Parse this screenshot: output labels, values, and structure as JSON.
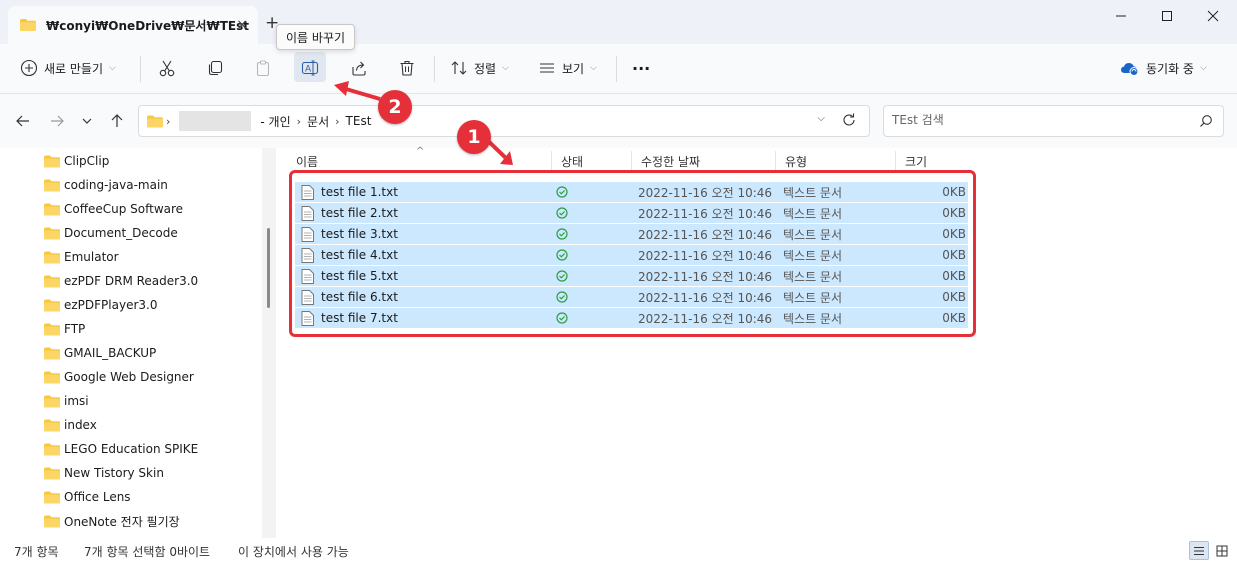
{
  "window": {
    "tab_title": "₩conyi₩OneDrive₩문서₩TEst",
    "tab_close": "×",
    "tab_add": "+"
  },
  "tooltip": {
    "text": "이름 바꾸기"
  },
  "toolbar": {
    "new_label": "새로 만들기",
    "sort_label": "정렬",
    "view_label": "보기",
    "more_label": "···",
    "sync_label": "동기화 중"
  },
  "address": {
    "crumbs": [
      "- 개인",
      "문서",
      "TEst"
    ],
    "search_placeholder": "TEst 검색"
  },
  "sidebar": {
    "items": [
      "ClipClip",
      "coding-java-main",
      "CoffeeCup Software",
      "Document_Decode",
      "Emulator",
      "ezPDF DRM Reader3.0",
      "ezPDFPlayer3.0",
      "FTP",
      "GMAIL_BACKUP",
      "Google Web Designer",
      "imsi",
      "index",
      "LEGO Education SPIKE",
      "New Tistory Skin",
      "Office Lens",
      "OneNote 전자 필기장"
    ]
  },
  "columns": {
    "name": "이름",
    "status": "상태",
    "modified": "수정한 날짜",
    "type": "유형",
    "size": "크기"
  },
  "files": [
    {
      "name": "test file 1.txt",
      "modified": "2022-11-16 오전 10:46",
      "type": "텍스트 문서",
      "size": "0KB"
    },
    {
      "name": "test file 2.txt",
      "modified": "2022-11-16 오전 10:46",
      "type": "텍스트 문서",
      "size": "0KB"
    },
    {
      "name": "test file 3.txt",
      "modified": "2022-11-16 오전 10:46",
      "type": "텍스트 문서",
      "size": "0KB"
    },
    {
      "name": "test file 4.txt",
      "modified": "2022-11-16 오전 10:46",
      "type": "텍스트 문서",
      "size": "0KB"
    },
    {
      "name": "test file 5.txt",
      "modified": "2022-11-16 오전 10:46",
      "type": "텍스트 문서",
      "size": "0KB"
    },
    {
      "name": "test file 6.txt",
      "modified": "2022-11-16 오전 10:46",
      "type": "텍스트 문서",
      "size": "0KB"
    },
    {
      "name": "test file 7.txt",
      "modified": "2022-11-16 오전 10:46",
      "type": "텍스트 문서",
      "size": "0KB"
    }
  ],
  "annotations": {
    "badge1": "1",
    "badge2": "2"
  },
  "status": {
    "count": "7개 항목",
    "selected": "7개 항목 선택함 0바이트",
    "availability": "이 장치에서 사용 가능"
  },
  "colors": {
    "selection": "#cce8ff",
    "annotation": "#e5303a",
    "folder": "#f7c843",
    "sync_ok": "#2e9e3e"
  }
}
